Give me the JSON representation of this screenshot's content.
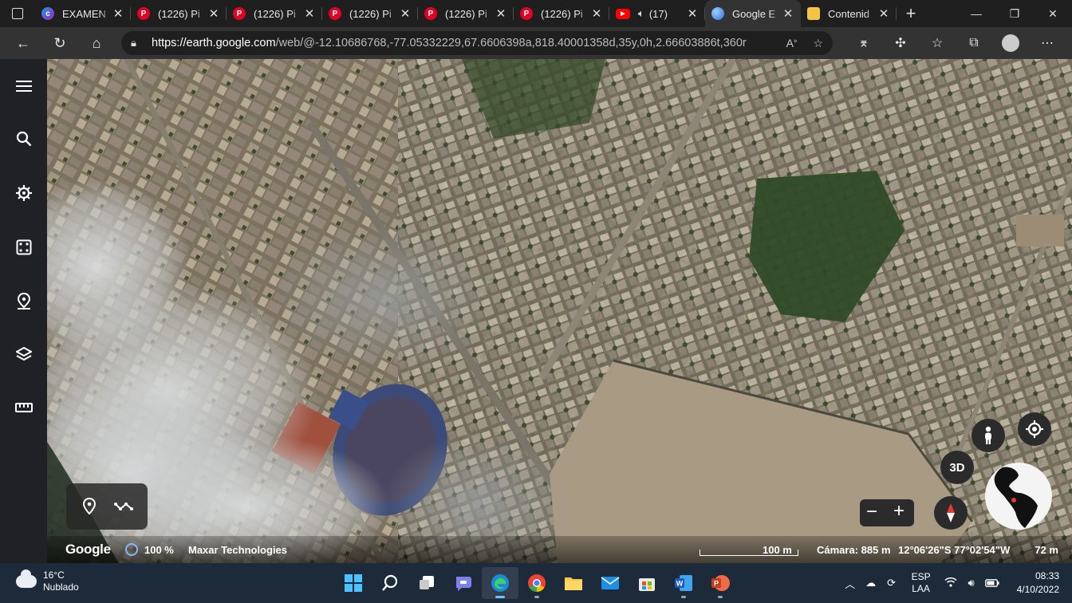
{
  "browser": {
    "tabs": [
      {
        "icon": "c-app-icon",
        "title": "EXAMEN",
        "active": false
      },
      {
        "icon": "pinterest-icon",
        "title": "(1226) Pi",
        "active": false
      },
      {
        "icon": "pinterest-icon",
        "title": "(1226) Pi",
        "active": false
      },
      {
        "icon": "pinterest-icon",
        "title": "(1226) Pi",
        "active": false
      },
      {
        "icon": "pinterest-icon",
        "title": "(1226) Pi",
        "active": false
      },
      {
        "icon": "pinterest-icon",
        "title": "(1226) Pi",
        "active": false
      },
      {
        "icon": "youtube-icon",
        "title": "(17)",
        "active": false
      },
      {
        "icon": "google-earth-icon",
        "title": "Google E",
        "active": true
      },
      {
        "icon": "notes-icon",
        "title": "Contenid",
        "active": false
      }
    ],
    "url_host": "https://earth.google.com",
    "url_path": "/web/@-12.10686768,-77.05332229,67.6606398a,818.40001358d,35y,0h,2.66603886t,360r"
  },
  "earth": {
    "logo": "Google",
    "progress": "100 %",
    "progress_value": 1.0,
    "attribution": "Maxar Technologies",
    "scale": "100 m",
    "camera": "Cámara: 885 m",
    "coords": "12°06'26\"S 77°02'54\"W",
    "altitude": "72 m",
    "view_3d": "3D",
    "zoom_out": "−",
    "zoom_in": "+"
  },
  "taskbar": {
    "temperature": "16°C",
    "weather": "Nublado",
    "lang_1": "ESP",
    "lang_2": "LAA",
    "time": "08:33",
    "date": "4/10/2022"
  },
  "colors": {
    "accent": "#8ab4f8",
    "taskbar": "#1c2a3a",
    "chrome": "#333333"
  }
}
